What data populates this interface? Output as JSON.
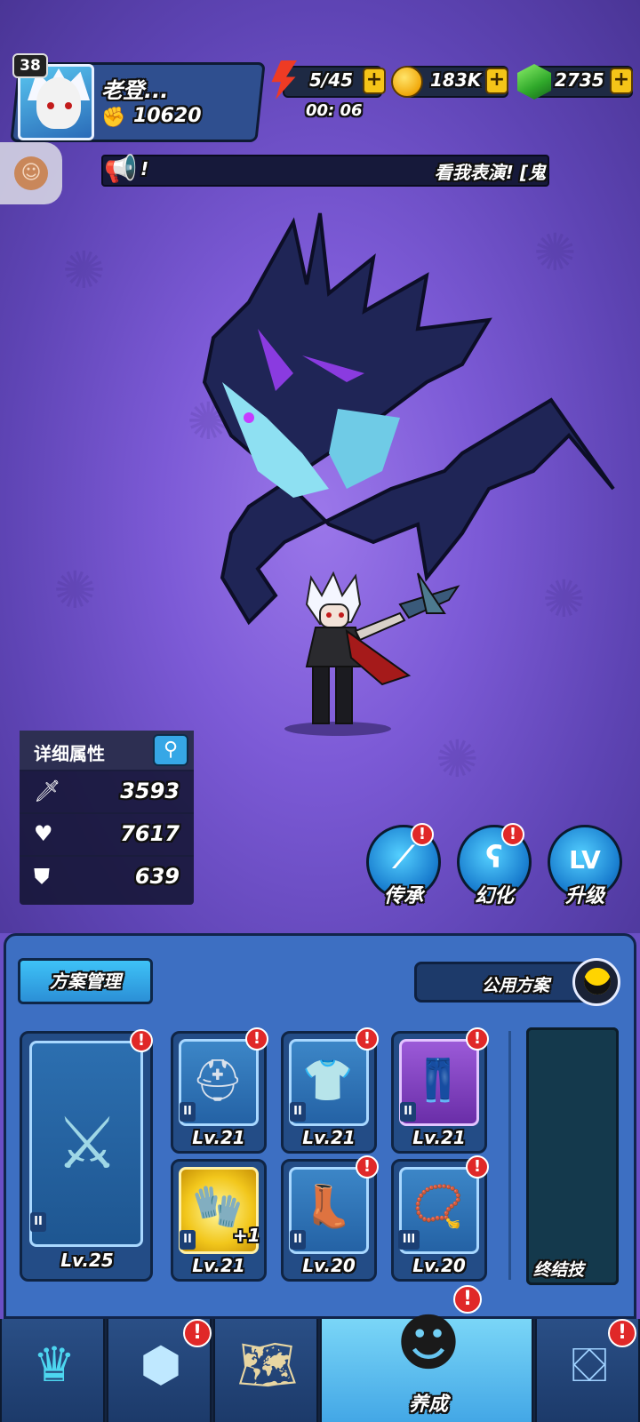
{
  "player": {
    "level": "38",
    "name": "老登...",
    "power": "10620"
  },
  "resources": {
    "energy": "5/45",
    "energy_timer": "00: 06",
    "gold": "183K",
    "gems": "2735",
    "plus": "+"
  },
  "announcement": {
    "prefix": "!",
    "text": "看我表演! [鬼"
  },
  "stats": {
    "title": "详细属性",
    "attack": "3593",
    "hp": "7617",
    "defense": "639"
  },
  "actions": [
    {
      "label": "传承",
      "glyph": "⟋"
    },
    {
      "label": "幻化",
      "glyph": "ʕ"
    },
    {
      "label": "升级",
      "glyph": "LV"
    }
  ],
  "equipment": {
    "plan_button": "方案管理",
    "public_plan": "公用方案",
    "weapon": {
      "level": "Lv.25",
      "tier": "II"
    },
    "slots": [
      {
        "name": "helmet",
        "level": "Lv.21",
        "tier": "II"
      },
      {
        "name": "armor",
        "level": "Lv.21",
        "tier": "II"
      },
      {
        "name": "pants",
        "level": "Lv.21",
        "tier": "II"
      },
      {
        "name": "gauntlet",
        "level": "Lv.21",
        "tier": "II",
        "bonus": "+1"
      },
      {
        "name": "boots",
        "level": "Lv.20",
        "tier": "II"
      },
      {
        "name": "necklace",
        "level": "Lv.20",
        "tier": "III"
      }
    ],
    "ultimate_label": "终结技"
  },
  "nav": {
    "active_label": "养成"
  },
  "alert_mark": "!",
  "colors": {
    "scene_bg": "#7c5ad6",
    "panel": "#3d6fc2",
    "alert": "#e02828",
    "gold": "#f5c418"
  }
}
